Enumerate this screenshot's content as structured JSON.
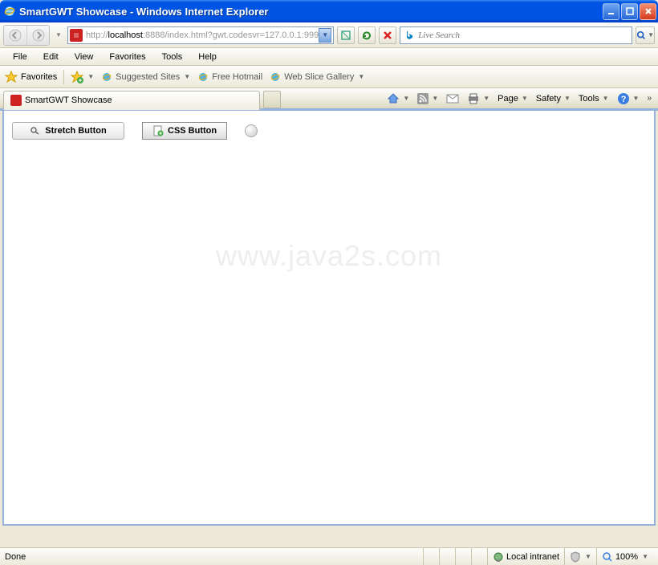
{
  "window": {
    "title": "SmartGWT Showcase - Windows Internet Explorer"
  },
  "address": {
    "prefix": "http://",
    "host": "localhost",
    "rest": ":8888/index.html?gwt.codesvr=127.0.0.1:999"
  },
  "search": {
    "placeholder": "Live Search"
  },
  "menu": {
    "file": "File",
    "edit": "Edit",
    "view": "View",
    "favorites": "Favorites",
    "tools": "Tools",
    "help": "Help"
  },
  "favbar": {
    "label": "Favorites",
    "suggested": "Suggested Sites",
    "hotmail": "Free Hotmail",
    "webslice": "Web Slice Gallery"
  },
  "tab": {
    "title": "SmartGWT Showcase"
  },
  "cmdbar": {
    "page": "Page",
    "safety": "Safety",
    "tools": "Tools"
  },
  "content": {
    "stretch_btn": "Stretch Button",
    "css_btn": "CSS Button",
    "watermark": "www.java2s.com"
  },
  "status": {
    "left": "Done",
    "zone": "Local intranet",
    "zoom": "100%"
  }
}
